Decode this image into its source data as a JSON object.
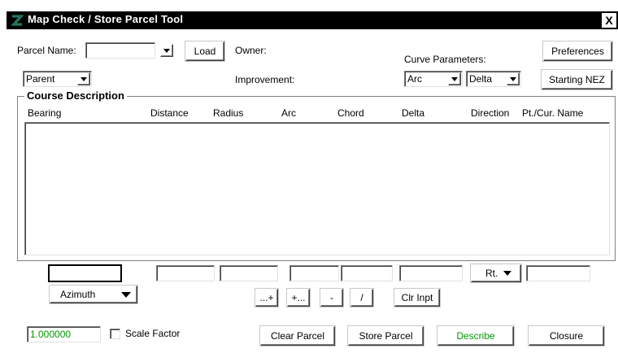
{
  "window": {
    "title": "Map Check / Store Parcel Tool",
    "close_glyph": "X",
    "icon": "app-logo-icon"
  },
  "colors": {
    "titlebar_bg": "#000000",
    "green_text": "#009900",
    "icon_green": "#2e9e3e",
    "icon_blue": "#2244aa"
  },
  "parcel": {
    "name_label": "Parcel Name:",
    "name_value": "",
    "load_label": "Load",
    "type_value": "Parent"
  },
  "owner_label": "Owner:",
  "improvement_label": "Improvement:",
  "curve": {
    "label": "Curve Parameters:",
    "param1": "Arc",
    "param2": "Delta"
  },
  "preferences_label": "Preferences",
  "starting_nez_label": "Starting NEZ",
  "course": {
    "title": "Course Description",
    "columns": [
      "Bearing",
      "Distance",
      "Radius",
      "Arc",
      "Chord",
      "Delta",
      "Direction",
      "Pt./Cur. Name"
    ]
  },
  "entry": {
    "direction_value": "Rt.",
    "bearing_mode": "Azimuth"
  },
  "ops": {
    "add_after": "...+",
    "add_before": "+...",
    "minus": "-",
    "slash": "/",
    "clear_input": "Clr Inpt"
  },
  "scale": {
    "value": "1.000000",
    "label": "Scale Factor",
    "checked": false
  },
  "actions": {
    "clear_parcel": "Clear Parcel",
    "store_parcel": "Store Parcel",
    "describe": "Describe",
    "closure": "Closure"
  }
}
